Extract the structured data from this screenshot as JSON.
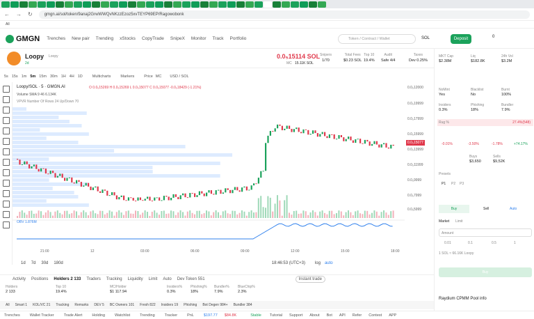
{
  "browser": {
    "url": "gmgn.ai/sol/token/9anaj2GrwWWQvNKzzEzoz5xvTEYP69EP/Ragowobonk",
    "bookmark": "All"
  },
  "header": {
    "logo": "GMGN",
    "nav": [
      "Trenches",
      "New pair",
      "Trending",
      "xStocks",
      "CopyTrade",
      "SnipeX",
      "Monitor",
      "Track",
      "Portfolio"
    ],
    "search_placeholder": "Token / Contract / Wallet",
    "chain": "SOL",
    "deposit": "Deposit",
    "balance": "0"
  },
  "token": {
    "name": "Loopy",
    "symbol": "Loopy",
    "age": "2d",
    "price": "0.0₅15114 SOL",
    "mc_label": "MC",
    "mc": "15.11K SOL",
    "snipers_label": "Snipers",
    "snipers": "1/70",
    "fees_label": "Total Fees",
    "fees": "$0.23 SOL",
    "top10_label": "Top 10",
    "top10": "19.4%",
    "audit_label": "Audit",
    "audit": "Safe 4/4",
    "taxes_label": "Taxes",
    "taxes": "Dev 0.25%"
  },
  "chart_tools": {
    "intervals": [
      "5s",
      "15s",
      "1m",
      "5m",
      "15m",
      "30m",
      "1H",
      "4H",
      "1D"
    ],
    "multicharts": "Multicharts",
    "markers": "Markers",
    "price": "Price",
    "mc": "MC",
    "usd": "USD / SOL"
  },
  "chart_header": {
    "pair": "Loopy/SOL · 5 · GMGN.AI",
    "ohlc": "O 0.0₅15269 H 0.0₅15269 L 0.0₅15077 C 0.0₅15077 -0.0₅18429 (-1.21%)",
    "volume": "Volume SMA 9 46 6.134K",
    "vpvr": "VPVR Number Of Rows 24 Up/Down 70",
    "obv": "OBV 1.876M"
  },
  "price_axis": [
    "0.0₅12000",
    "0.0₅19999",
    "0.0₅17999",
    "0.0₅15999",
    "0.0₅13999",
    "0.0₅11999",
    "0.0₅9999",
    "0.0₅7999",
    "0.0₅5999"
  ],
  "current_price": "0.0₅15077",
  "time_axis": [
    "21:00",
    "12",
    "03:00",
    "06:00",
    "09:00",
    "12:00",
    "15:00",
    "18:00"
  ],
  "bottom_tools": {
    "ranges": [
      "1d",
      "7d",
      "30d",
      "180d"
    ],
    "clock": "18:46:53 (UTC+3)",
    "log": "log",
    "auto": "auto"
  },
  "activity_tabs": [
    "Activity",
    "Positions",
    "Holders 2 133",
    "Traders",
    "Tracking",
    "Liquidity",
    "Limit",
    "Auto",
    "Dev Token 551"
  ],
  "instant_trade": "Instant trade",
  "holders": {
    "holders_label": "Holders",
    "holders": "2 133",
    "top10_label": "Top 10",
    "top10": "19.4%",
    "mc_label": "MC/Holder",
    "mc": "$1 117.94",
    "insiders_label": "Insiders%",
    "insiders": "0.3%",
    "phishing_label": "Phishing%",
    "phishing": "18%",
    "bundler_label": "Bundler%",
    "bundler": "7.9%",
    "bluechip_label": "BlueChip%",
    "bluechip": "2.3%"
  },
  "filters": [
    "All",
    "Smart 1",
    "KOL/VC 21",
    "Tracking",
    "Remarks",
    "DEV 5",
    "BC Owners 101",
    "Fresh 822",
    "Insiders 19",
    "Phishing",
    "Bot Degen 984+",
    "Bundler 384"
  ],
  "statusbar": [
    "Trenches",
    "Wallet Tracker",
    "Trade Alert",
    "Holding",
    "Watchlist",
    "Trending",
    "Tracker",
    "PnL",
    "$197.77",
    "$84.8K",
    "Stable",
    "Tutorial",
    "Support",
    "About",
    "Bot",
    "API",
    "Refer",
    "Contest",
    "APP"
  ],
  "right": {
    "mcap_label": "MKT Cap",
    "mcap": "$2.38M",
    "liq_label": "Liq",
    "liq": "$182.8K",
    "vol_label": "24h Vol",
    "vol": "$3.2M",
    "nomint": "NoMint",
    "nomint_v": "Yes",
    "blacklist": "Blacklist",
    "blacklist_v": "No",
    "burnt": "Burnt",
    "burnt_v": "100%",
    "insiders": "Insiders",
    "insiders_v": "0.3%",
    "phishing": "Phishing",
    "phishing_v": "18%",
    "bundler": "Bundler",
    "bundler_v": "7.9%",
    "rug": "Rug %",
    "rug_v": "27.4%(548)",
    "p1m": "-0.01%",
    "p5m": "-3.50%",
    "p1h": "-1.78%",
    "p24h": "+74.17%",
    "buys_label": "Buys",
    "buys": "$3,650",
    "sells_label": "Sells",
    "sells": "$9,52K",
    "presets": "Presets",
    "p_tabs": [
      "P1",
      "P2",
      "P3"
    ],
    "buy": "Buy",
    "sell": "Sell",
    "auto": "Auto",
    "market": "Market",
    "limit": "Limit",
    "amount": "Amount",
    "amounts": [
      "0.01",
      "0.1",
      "0.5",
      "1"
    ],
    "rate": "1 SOL ≈ 66.16K Loopy",
    "buy_btn": "Buy",
    "pool": "Raydium CPMM Pool info"
  }
}
